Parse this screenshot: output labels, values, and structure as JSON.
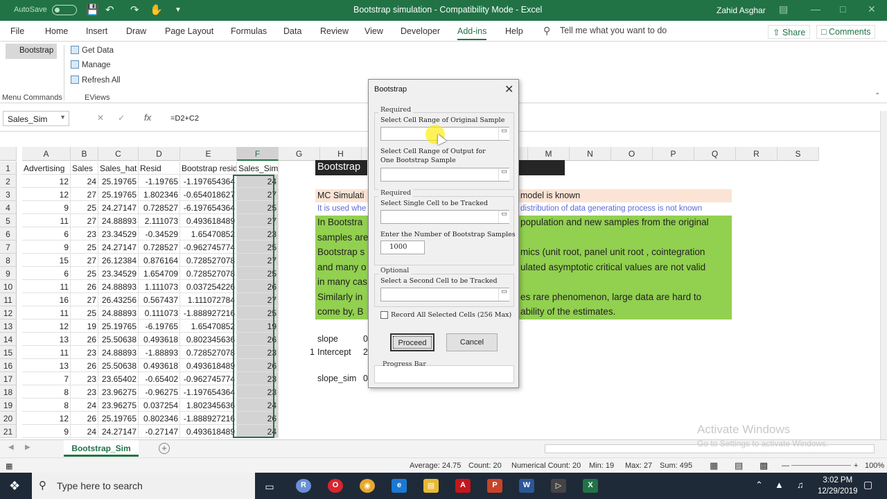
{
  "titlebar": {
    "autosave": "AutoSave",
    "autosave_state": "Off",
    "title": "Bootstrap simulation  -  Compatibility Mode  -  Excel",
    "user": "Zahid Asghar"
  },
  "tabs": [
    "File",
    "Home",
    "Insert",
    "Draw",
    "Page Layout",
    "Formulas",
    "Data",
    "Review",
    "View",
    "Developer",
    "Add-ins",
    "Help"
  ],
  "active_tab": "Add-ins",
  "tell_me": "Tell me what you want to do",
  "share": "Share",
  "comments": "Comments",
  "ribbon": {
    "bootstrap": "Bootstrap",
    "group1": "Menu Commands",
    "get_data": "Get Data",
    "manage": "Manage",
    "refresh_all": "Refresh All",
    "group2": "EViews"
  },
  "formula_bar": {
    "name_box": "Sales_Sim",
    "fx": "fx",
    "formula": "=D2+C2"
  },
  "columns": [
    "A",
    "B",
    "C",
    "D",
    "E",
    "F",
    "G",
    "H",
    "I",
    "J",
    "K",
    "L",
    "M",
    "N",
    "O",
    "P",
    "Q",
    "R",
    "S",
    "T"
  ],
  "rows": [
    [
      "Advertising",
      "Sales",
      "Sales_hat",
      "Resid",
      "Bootstrap resid",
      "Sales_Sim"
    ],
    [
      "12",
      "24",
      "25.19765",
      "-1.19765",
      "-1.197654364",
      "24"
    ],
    [
      "12",
      "27",
      "25.19765",
      "1.802346",
      "-0.654018627",
      "27"
    ],
    [
      "9",
      "25",
      "24.27147",
      "0.728527",
      "-6.197654364",
      "25"
    ],
    [
      "11",
      "27",
      "24.88893",
      "2.111073",
      "0.493618489",
      "27"
    ],
    [
      "6",
      "23",
      "23.34529",
      "-0.34529",
      "1.65470852",
      "23"
    ],
    [
      "9",
      "25",
      "24.27147",
      "0.728527",
      "-0.962745774",
      "25"
    ],
    [
      "15",
      "27",
      "26.12384",
      "0.876164",
      "0.728527078",
      "27"
    ],
    [
      "6",
      "25",
      "23.34529",
      "1.654709",
      "0.728527078",
      "25"
    ],
    [
      "11",
      "26",
      "24.88893",
      "1.111073",
      "0.037254226",
      "26"
    ],
    [
      "16",
      "27",
      "26.43256",
      "0.567437",
      "1.111072784",
      "27"
    ],
    [
      "11",
      "25",
      "24.88893",
      "0.111073",
      "-1.888927216",
      "25"
    ],
    [
      "12",
      "19",
      "25.19765",
      "-6.19765",
      "1.65470852",
      "19"
    ],
    [
      "13",
      "26",
      "25.50638",
      "0.493618",
      "0.802345636",
      "26"
    ],
    [
      "11",
      "23",
      "24.88893",
      "-1.88893",
      "0.728527078",
      "23"
    ],
    [
      "13",
      "26",
      "25.50638",
      "0.493618",
      "0.493618489",
      "26"
    ],
    [
      "7",
      "23",
      "23.65402",
      "-0.65402",
      "-0.962745774",
      "23"
    ],
    [
      "8",
      "23",
      "23.96275",
      "-0.96275",
      "-1.197654364",
      "23"
    ],
    [
      "8",
      "24",
      "23.96275",
      "0.037254",
      "1.802345636",
      "24"
    ],
    [
      "12",
      "26",
      "25.19765",
      "0.802346",
      "-1.888927216",
      "26"
    ],
    [
      "9",
      "24",
      "24.27147",
      "-0.27147",
      "0.493618489",
      "24"
    ]
  ],
  "right_panel": {
    "header": "Bootstrap",
    "line_mc_left": "MC Simulati",
    "line_mc_right": "model is known",
    "line_used_left": "It is used whe",
    "line_used_right": "distribution of data generating process is not known",
    "g5_left": "In Bootstra",
    "g5_right": "population and new samples from the original",
    "g6_left": "samples are",
    "g7_left": "Bootstrap s",
    "g7_right": "mics (unit root, panel unit root , cointegration",
    "g8_left": "and many o",
    "g8_right": "ulated asymptotic critical values are not valid",
    "g9_left": "in many cas",
    "g10_left": "Similarly in",
    "g10_right": "es rare phenomenon, large data are hard to",
    "g11_left": "come by, B",
    "g11_right": "ability of the estimates.",
    "slope": "slope",
    "slope_val": "0",
    "intercept_num": "1",
    "intercept": "Intercept",
    "intercept_val": "2",
    "slope_sim": "slope_sim",
    "slope_sim_val": "0"
  },
  "sheet_tab": "Bootstrap_Sim",
  "status": {
    "average": "Average: 24.75",
    "count": "Count: 20",
    "numerical_count": "Numerical Count: 20",
    "min": "Min: 19",
    "max": "Max: 27",
    "sum": "Sum: 495",
    "zoom": "100%"
  },
  "watermark": {
    "line1": "Activate Windows",
    "line2": "Go to Settings to activate Windows."
  },
  "dialog": {
    "title": "Bootstrap",
    "required1": "Required",
    "label_original": "Select Cell Range of Original Sample",
    "label_output": "Select Cell Range of Output for One Bootstrap Sample",
    "required2": "Required",
    "label_single": "Select Single Cell to be Tracked",
    "label_number": "Enter the Number of Bootstrap Samples",
    "number_value": "1000",
    "optional": "Optional",
    "label_second": "Select a Second Cell to be Tracked",
    "record_label": "Record All Selected Cells (256 Max)",
    "proceed": "Proceed",
    "cancel": "Cancel",
    "progress_bar": "Progress Bar"
  },
  "taskbar": {
    "search": "Type here to search",
    "time": "3:02 PM",
    "date": "12/29/2019"
  },
  "colors": {
    "excel_green": "#217346",
    "peach": "#fbe4d5",
    "green_fill": "#92d050",
    "header_dark": "#262626"
  }
}
